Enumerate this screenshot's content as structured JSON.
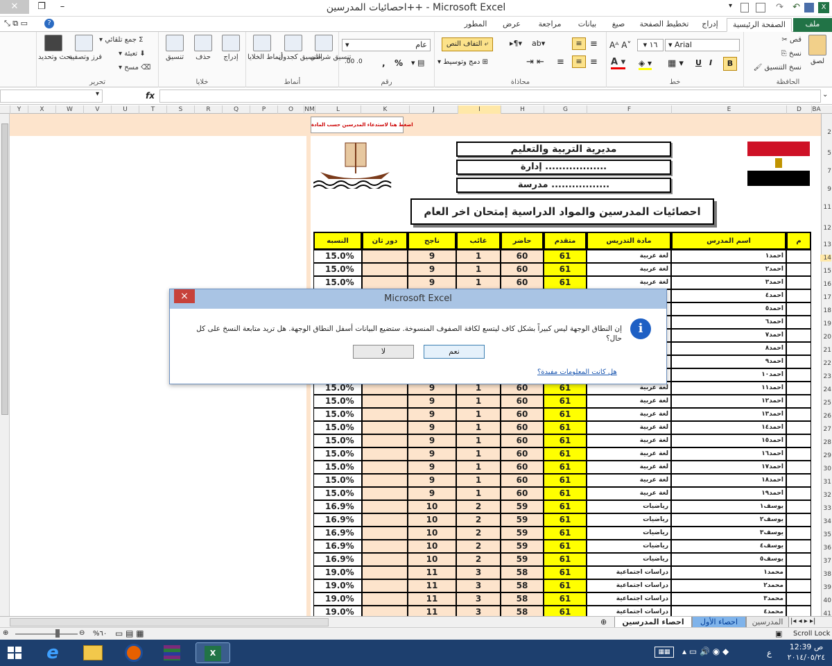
{
  "window": {
    "title": "احصائيات المدرسين++ - Microsoft Excel",
    "qat_icons": [
      "excel-icon",
      "save-icon",
      "undo-icon",
      "redo-icon",
      "print-preview-icon",
      "new-icon",
      "customize-qat-icon"
    ]
  },
  "ribbon_tabs": [
    "ملف",
    "الصفحة الرئيسية",
    "إدراج",
    "تخطيط الصفحة",
    "صيغ",
    "بيانات",
    "مراجعة",
    "عرض",
    "المطور"
  ],
  "ribbon": {
    "clipboard": {
      "label": "الحافظة",
      "paste": "لصق",
      "cut": "قص",
      "copy": "نسخ",
      "format_painter": "نسخ التنسيق"
    },
    "font": {
      "label": "خط",
      "name": "Arial",
      "size": "١٦"
    },
    "alignment": {
      "label": "محاذاة",
      "wrap": "التفاف النص",
      "merge": "دمج وتوسيط"
    },
    "number": {
      "label": "رقم",
      "format": "عام"
    },
    "styles": {
      "label": "أنماط",
      "conditional": "تنسيق شرطي",
      "as_table": "التنسيق كجدول",
      "cell_styles": "أنماط الخلايا"
    },
    "cells": {
      "label": "خلايا",
      "insert": "إدراج",
      "delete": "حذف",
      "format": "تنسيق"
    },
    "editing": {
      "label": "تحرير",
      "autosum": "جمع تلقائي",
      "fill": "تعبئة",
      "clear": "مسح",
      "sort": "فرز وتصفية",
      "find": "بحث وتحديد"
    }
  },
  "formula_bar": {
    "fx": "fx",
    "value": ""
  },
  "columns": [
    "Y",
    "X",
    "W",
    "V",
    "U",
    "T",
    "S",
    "R",
    "Q",
    "P",
    "O",
    "NM",
    "L",
    "K",
    "J",
    "I",
    "H",
    "G",
    "F",
    "E",
    "D",
    "BA"
  ],
  "rows": [
    "2",
    "5",
    "7",
    "9",
    "11",
    "12",
    "13",
    "14",
    "15",
    "16",
    "17",
    "18",
    "19",
    "20",
    "21",
    "22",
    "23",
    "24",
    "25",
    "26",
    "27",
    "28",
    "29",
    "30",
    "31",
    "32",
    "33",
    "34",
    "35",
    "36",
    "37",
    "38",
    "39",
    "40",
    "41"
  ],
  "sheet": {
    "banner_note": "اضغط هنا لاستدعاء المدرسين حسب المادة",
    "directorate": "مديرية التربية والتعليم",
    "administration": "إدارة ..................",
    "school": "مدرسة .................",
    "main_title": "احصائيات المدرسين والمواد الدراسية إمتحان اخر العام",
    "headers": {
      "m": "م",
      "teacher": "اسم المدرس",
      "subject": "مادة التدريس",
      "advanced": "متقدم",
      "present": "حاضر",
      "absent": "غائب",
      "passed": "ناجح",
      "second_round": "دور ثان",
      "ratio": "النسبه"
    },
    "rows": [
      [
        "15.0%",
        "9",
        "1",
        "60",
        "61",
        "لغة عربية",
        "احمد١"
      ],
      [
        "15.0%",
        "9",
        "1",
        "60",
        "61",
        "لغة عربية",
        "احمد٢"
      ],
      [
        "15.0%",
        "9",
        "1",
        "60",
        "61",
        "لغة عربية",
        "احمد٣"
      ],
      [
        "",
        "",
        "",
        "",
        "",
        "",
        "احمد٤"
      ],
      [
        "",
        "",
        "",
        "",
        "",
        "",
        "احمد٥"
      ],
      [
        "",
        "",
        "",
        "",
        "",
        "",
        "احمد٦"
      ],
      [
        "",
        "",
        "",
        "",
        "",
        "",
        "احمد٧"
      ],
      [
        "",
        "",
        "",
        "",
        "",
        "",
        "احمد٨"
      ],
      [
        "",
        "",
        "",
        "",
        "",
        "",
        "احمد٩"
      ],
      [
        "",
        "",
        "",
        "",
        "",
        "",
        "احمد١٠"
      ],
      [
        "15.0%",
        "9",
        "1",
        "60",
        "61",
        "لغة عربية",
        "احمد١١"
      ],
      [
        "15.0%",
        "9",
        "1",
        "60",
        "61",
        "لغة عربية",
        "احمد١٢"
      ],
      [
        "15.0%",
        "9",
        "1",
        "60",
        "61",
        "لغة عربية",
        "احمد١٣"
      ],
      [
        "15.0%",
        "9",
        "1",
        "60",
        "61",
        "لغة عربية",
        "احمد١٤"
      ],
      [
        "15.0%",
        "9",
        "1",
        "60",
        "61",
        "لغة عربية",
        "احمد١٥"
      ],
      [
        "15.0%",
        "9",
        "1",
        "60",
        "61",
        "لغة عربية",
        "احمد١٦"
      ],
      [
        "15.0%",
        "9",
        "1",
        "60",
        "61",
        "لغة عربية",
        "احمد١٧"
      ],
      [
        "15.0%",
        "9",
        "1",
        "60",
        "61",
        "لغة عربية",
        "احمد١٨"
      ],
      [
        "15.0%",
        "9",
        "1",
        "60",
        "61",
        "لغة عربية",
        "احمد١٩"
      ],
      [
        "16.9%",
        "10",
        "2",
        "59",
        "61",
        "رياضيات",
        "يوسف١"
      ],
      [
        "16.9%",
        "10",
        "2",
        "59",
        "61",
        "رياضيات",
        "يوسف٢"
      ],
      [
        "16.9%",
        "10",
        "2",
        "59",
        "61",
        "رياضيات",
        "يوسف٣"
      ],
      [
        "16.9%",
        "10",
        "2",
        "59",
        "61",
        "رياضيات",
        "يوسف٤"
      ],
      [
        "16.9%",
        "10",
        "2",
        "59",
        "61",
        "رياضيات",
        "يوسف٥"
      ],
      [
        "19.0%",
        "11",
        "3",
        "58",
        "61",
        "دراسات اجتماعية",
        "محمد١"
      ],
      [
        "19.0%",
        "11",
        "3",
        "58",
        "61",
        "دراسات اجتماعية",
        "محمد٢"
      ],
      [
        "19.0%",
        "11",
        "3",
        "58",
        "61",
        "دراسات اجتماعية",
        "محمد٣"
      ],
      [
        "19.0%",
        "11",
        "3",
        "58",
        "61",
        "دراسات اجتماعية",
        "محمد٤"
      ]
    ]
  },
  "sheet_tabs": [
    "احصاء المدرسين",
    "احصاء الأول",
    "المدرسين"
  ],
  "status": {
    "zoom": "%٦٠",
    "scroll_lock": "Scroll Lock"
  },
  "taskbar": {
    "time": "12:39 ص",
    "date": "٢٠١٤/٠٥/٢٤",
    "lang": "ع"
  },
  "dialog": {
    "title": "Microsoft Excel",
    "message": "إن النطاق الوجهة ليس كبيراً بشكل كاف ليتسع لكافة الصفوف المنسوخة. ستضيع البيانات أسفل النطاق الوجهة. هل تريد متابعة النسخ على كل حال؟",
    "yes": "نعم",
    "no": "لا",
    "help_link": "هل كانت المعلومات مفيدة؟",
    "close": "×"
  },
  "colors": {
    "yellow": "#ffff00",
    "peach": "#fde4cc",
    "accent": "#217346",
    "dialog_title": "#a9c4e4"
  }
}
